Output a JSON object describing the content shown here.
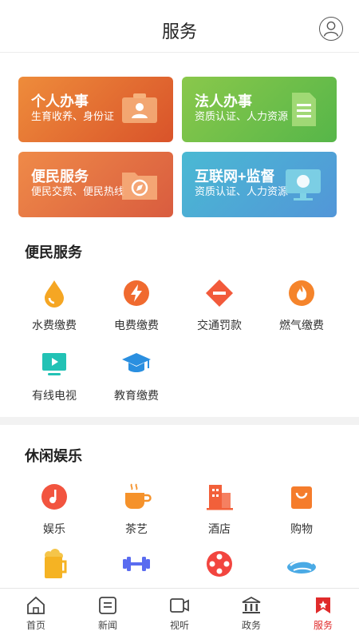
{
  "header": {
    "title": "服务"
  },
  "cards": [
    {
      "title": "个人办事",
      "subtitle": "生育收养、身份证",
      "icon": "id-card-icon"
    },
    {
      "title": "法人办事",
      "subtitle": "资质认证、人力资源",
      "icon": "document-icon"
    },
    {
      "title": "便民服务",
      "subtitle": "便民交费、便民热线",
      "icon": "folder-compass-icon"
    },
    {
      "title": "互联网+监督",
      "subtitle": "资质认证、人力资源",
      "icon": "monitor-icon"
    }
  ],
  "sections": {
    "convenience": {
      "title": "便民服务",
      "items": [
        {
          "label": "水费缴费",
          "icon": "water-drop-icon",
          "color": "#f5a623"
        },
        {
          "label": "电费缴费",
          "icon": "lightning-icon",
          "color": "#f06a2f"
        },
        {
          "label": "交通罚款",
          "icon": "no-entry-icon",
          "color": "#f25a3b"
        },
        {
          "label": "燃气缴费",
          "icon": "flame-icon",
          "color": "#f5842b"
        },
        {
          "label": "有线电视",
          "icon": "tv-icon",
          "color": "#22c2b5"
        },
        {
          "label": "教育缴费",
          "icon": "graduation-cap-icon",
          "color": "#2a8fe0"
        }
      ]
    },
    "leisure": {
      "title": "休闲娱乐",
      "items": [
        {
          "label": "娱乐",
          "icon": "music-icon",
          "color": "#f2543f"
        },
        {
          "label": "茶艺",
          "icon": "tea-cup-icon",
          "color": "#f5922b"
        },
        {
          "label": "酒店",
          "icon": "hotel-icon",
          "color": "#f2603a"
        },
        {
          "label": "购物",
          "icon": "shopping-bag-icon",
          "color": "#f57c2b"
        },
        {
          "label": "",
          "icon": "beer-icon",
          "color": "#f5b323"
        },
        {
          "label": "",
          "icon": "dumbbell-icon",
          "color": "#5a6cf0"
        },
        {
          "label": "",
          "icon": "film-reel-icon",
          "color": "#f2453f"
        },
        {
          "label": "",
          "icon": "swim-icon",
          "color": "#2a9be0"
        }
      ]
    }
  },
  "tabbar": {
    "items": [
      {
        "label": "首页",
        "icon": "home-icon",
        "active": false
      },
      {
        "label": "新闻",
        "icon": "news-icon",
        "active": false
      },
      {
        "label": "视听",
        "icon": "video-icon",
        "active": false
      },
      {
        "label": "政务",
        "icon": "government-icon",
        "active": false
      },
      {
        "label": "服务",
        "icon": "service-icon",
        "active": true
      }
    ]
  },
  "colors": {
    "active_tab": "#e02b2b",
    "divider": "#f2f2f2"
  }
}
